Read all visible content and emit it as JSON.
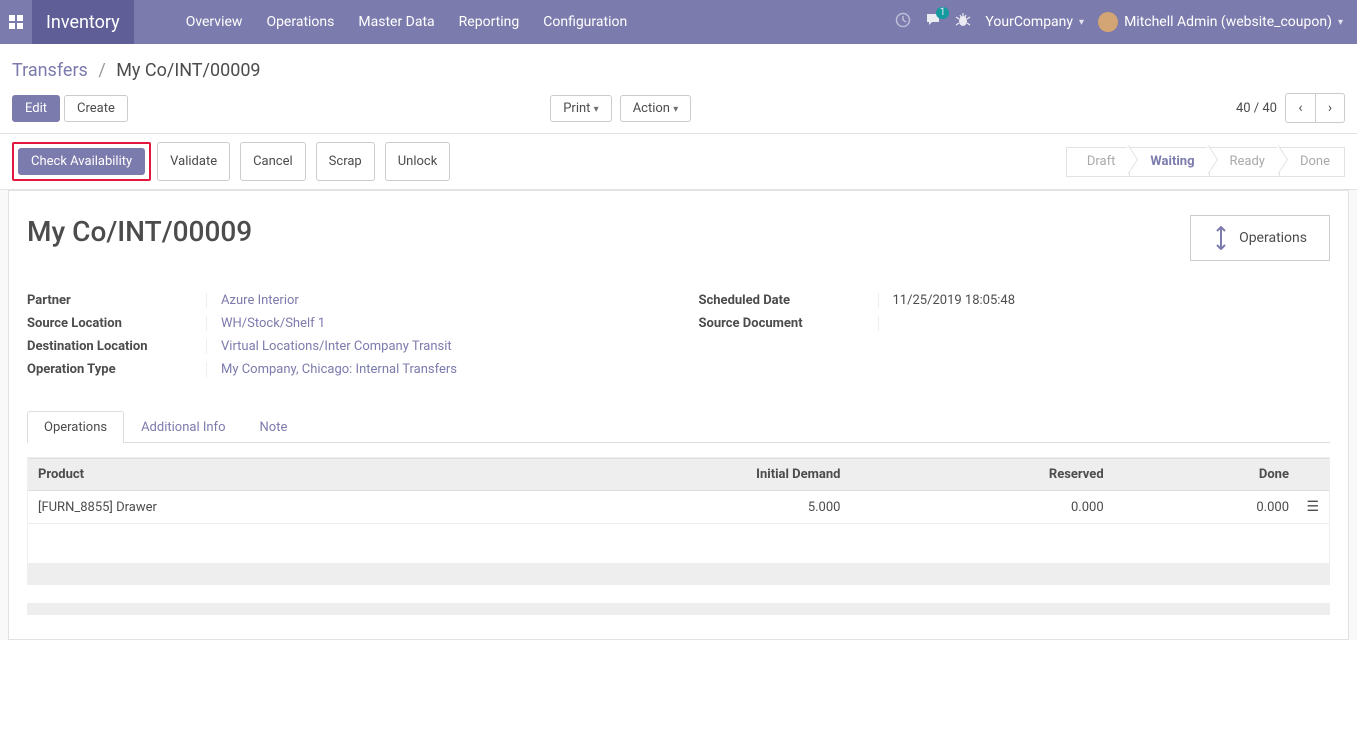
{
  "nav": {
    "brand": "Inventory",
    "menu": [
      "Overview",
      "Operations",
      "Master Data",
      "Reporting",
      "Configuration"
    ],
    "msg_count": "1",
    "company": "YourCompany",
    "user": "Mitchell Admin (website_coupon)"
  },
  "breadcrumb": {
    "parent": "Transfers",
    "current": "My Co/INT/00009"
  },
  "buttons": {
    "edit": "Edit",
    "create": "Create",
    "print": "Print",
    "action": "Action",
    "check_availability": "Check Availability",
    "validate": "Validate",
    "cancel": "Cancel",
    "scrap": "Scrap",
    "unlock": "Unlock"
  },
  "pager": {
    "text": "40 / 40"
  },
  "status": {
    "steps": [
      "Draft",
      "Waiting",
      "Ready",
      "Done"
    ],
    "active": "Waiting"
  },
  "record": {
    "title": "My Co/INT/00009",
    "operations_btn": "Operations",
    "fields_left": {
      "partner_label": "Partner",
      "partner_value": "Azure Interior",
      "src_label": "Source Location",
      "src_value": "WH/Stock/Shelf 1",
      "dest_label": "Destination Location",
      "dest_value": "Virtual Locations/Inter Company Transit",
      "optype_label": "Operation Type",
      "optype_value": "My Company, Chicago: Internal Transfers"
    },
    "fields_right": {
      "sched_label": "Scheduled Date",
      "sched_value": "11/25/2019 18:05:48",
      "srcdoc_label": "Source Document",
      "srcdoc_value": ""
    }
  },
  "tabs": [
    "Operations",
    "Additional Info",
    "Note"
  ],
  "table": {
    "headers": {
      "product": "Product",
      "initial": "Initial Demand",
      "reserved": "Reserved",
      "done": "Done"
    },
    "rows": [
      {
        "product": "[FURN_8855] Drawer",
        "initial": "5.000",
        "reserved": "0.000",
        "done": "0.000"
      }
    ]
  }
}
